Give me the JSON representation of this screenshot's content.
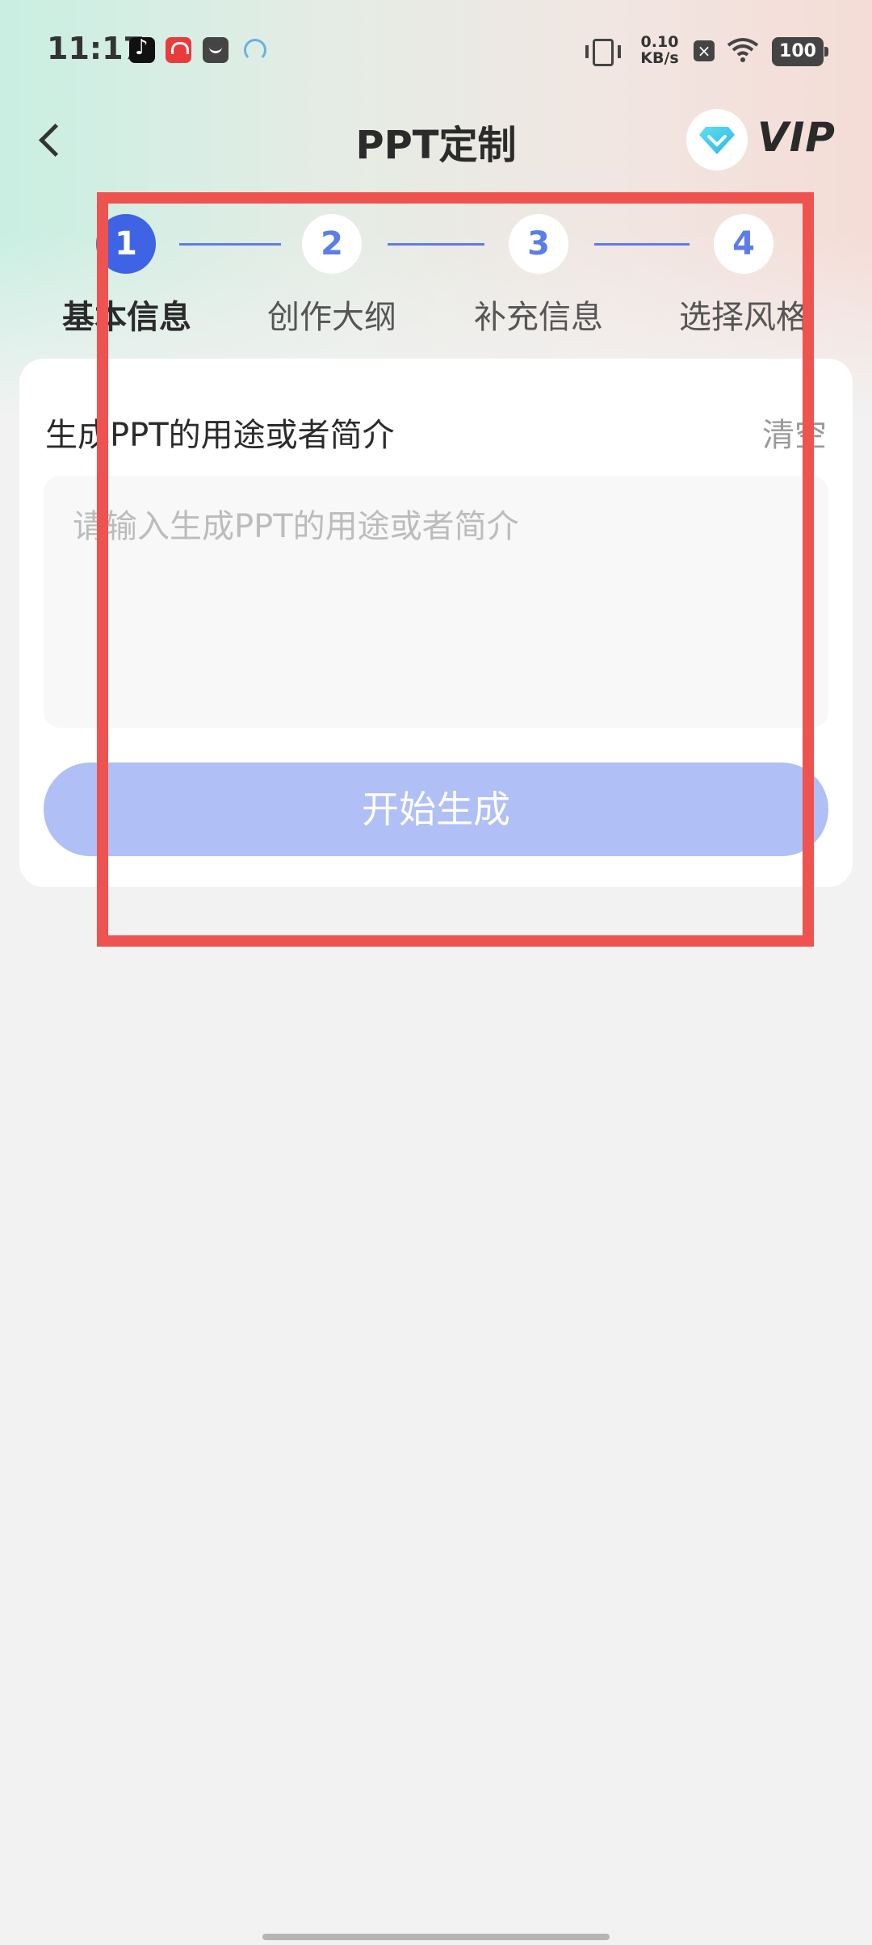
{
  "status_bar": {
    "time": "11:17",
    "net_speed_value": "0.10",
    "net_speed_unit": "KB/s",
    "battery": "100",
    "icons": [
      "tiktok-icon",
      "app-icon",
      "bag-icon",
      "headset-icon",
      "vibrate-icon",
      "close-notification-icon",
      "wifi-icon",
      "battery-icon"
    ]
  },
  "header": {
    "title": "PPT定制",
    "vip_label": "VIP"
  },
  "stepper": {
    "steps": [
      {
        "number": "1",
        "label": "基本信息",
        "active": true
      },
      {
        "number": "2",
        "label": "创作大纲",
        "active": false
      },
      {
        "number": "3",
        "label": "补充信息",
        "active": false
      },
      {
        "number": "4",
        "label": "选择风格",
        "active": false
      }
    ]
  },
  "form": {
    "field_label": "生成PPT的用途或者简介",
    "clear_label": "清空",
    "input_placeholder": "请输入生成PPT的用途或者简介",
    "input_value": "",
    "submit_label": "开始生成"
  },
  "colors": {
    "accent": "#3f63e5",
    "step_inactive": "#5c7de8",
    "button_disabled": "#b0bff5",
    "highlight": "#ee5350",
    "background": "#f2f2f2"
  }
}
